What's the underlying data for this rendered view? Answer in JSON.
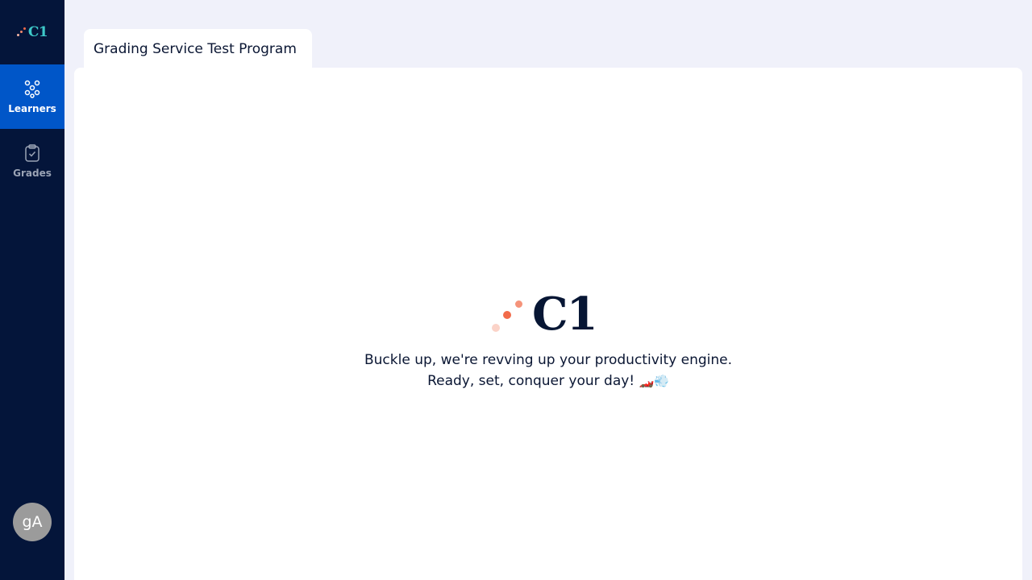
{
  "brand": {
    "name": "C1"
  },
  "sidebar": {
    "items": [
      {
        "label": "Learners",
        "icon": "people-group-icon",
        "active": true
      },
      {
        "label": "Grades",
        "icon": "clipboard-check-icon",
        "active": false
      }
    ],
    "avatar_initials": "gA"
  },
  "tab": {
    "title": "Grading Service Test Program"
  },
  "loading": {
    "logo_text": "C1",
    "line1": "Buckle up, we're revving up your productivity engine.",
    "line2": "Ready, set, conquer your day!",
    "line2_emojis": "🏎️💨"
  },
  "colors": {
    "sidebar_bg": "#04153a",
    "active_nav": "#0056c8",
    "brand_teal": "#3ec9c9",
    "logo_dark": "#071634",
    "dot_accent": "#f26b4a",
    "page_bg": "#f0f1fa"
  }
}
